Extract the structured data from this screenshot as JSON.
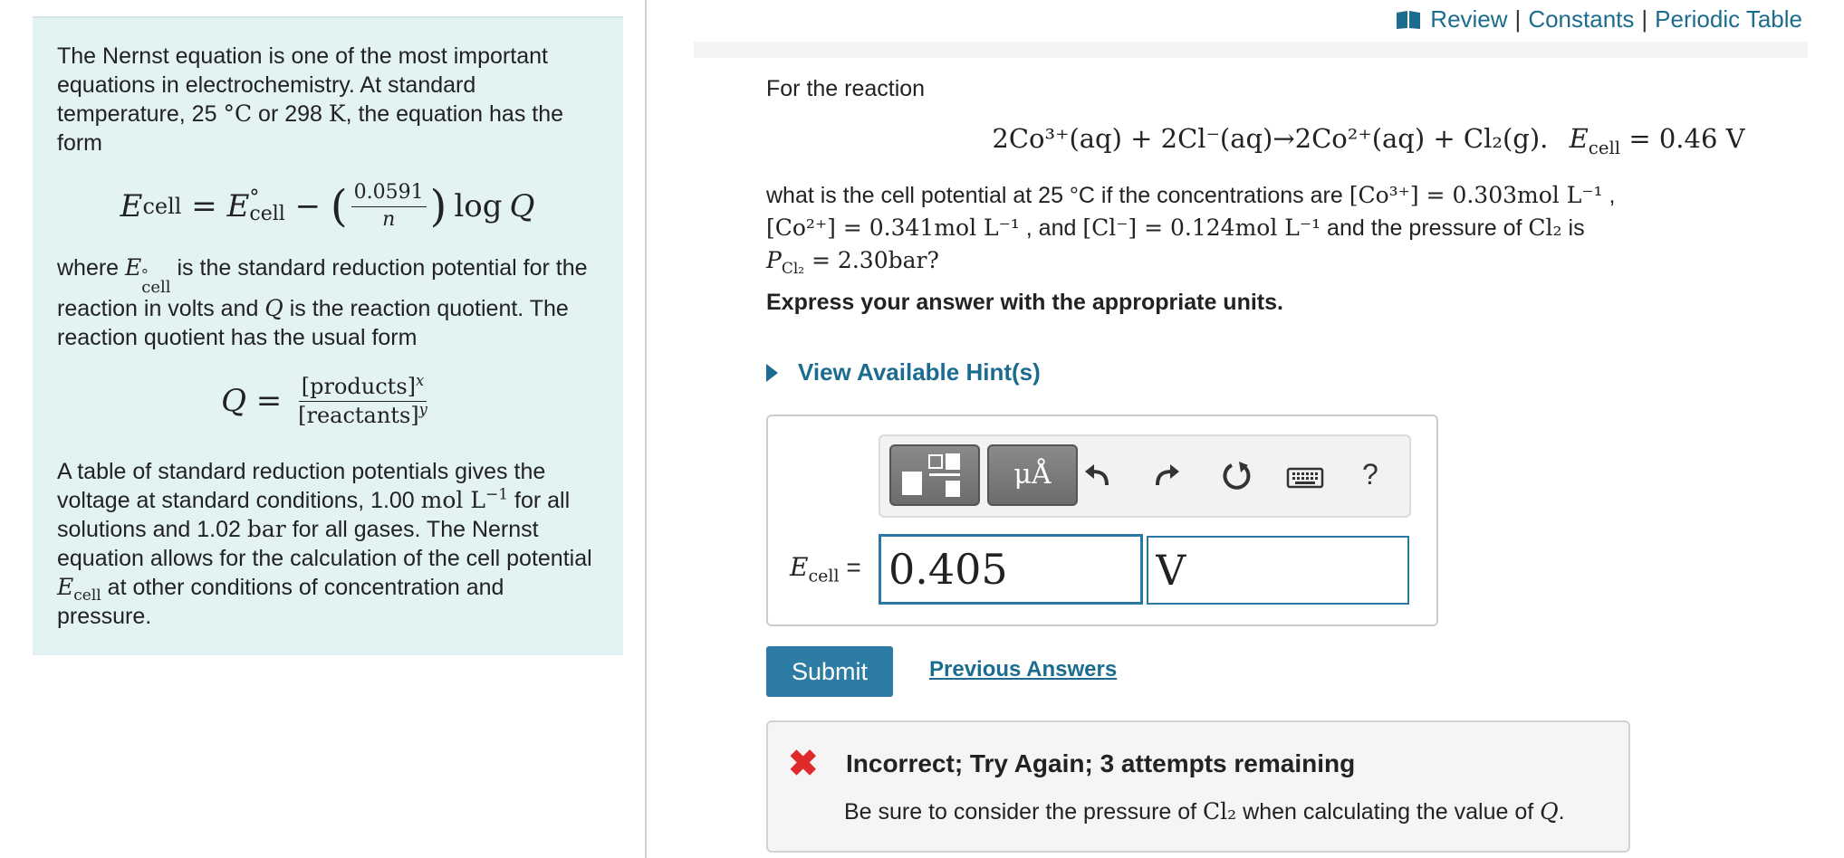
{
  "left": {
    "p1_text": "The Nernst equation is one of the most important equations in electrochemistry. At standard temperature, 25",
    "p1_deg": "°C",
    "p1_or": " or 298 ",
    "p1_k": "K",
    "p1_end": ", the equation has the form",
    "eq_nernst": {
      "lhs": "E",
      "lhs_sub": "cell",
      "eq": " = ",
      "e0": "E",
      "e0_sup": "°",
      "e0_sub": "cell",
      "minus": " − ",
      "num": "0.0591",
      "den": "n",
      "log": "log",
      "q": "Q"
    },
    "p2_where": "where ",
    "p2_e": "E",
    "p2_sup": "°",
    "p2_sub": "cell",
    "p2_mid": " is the standard reduction potential for the reaction in volts and ",
    "p2_q": "Q",
    "p2_end": " is the reaction quotient. The reaction quotient has the usual form",
    "eq_q": {
      "lhs": "Q",
      "eq": " = ",
      "num": "[products]",
      "num_sup": "x",
      "den": "[reactants]",
      "den_sup": "y"
    },
    "p3_a": "A table of standard reduction potentials gives the voltage at standard conditions, 1.00 ",
    "p3_unit": "mol L",
    "p3_unit_sup": "−1",
    "p3_b": " for all solutions and 1.02 ",
    "p3_bar": "bar",
    "p3_c": " for all gases. The Nernst equation allows for the calculation of the cell potential ",
    "p3_e": "E",
    "p3_esub": "cell",
    "p3_d": " at other conditions of concentration and pressure."
  },
  "top_links": {
    "review": "Review",
    "constants": "Constants",
    "periodic": "Periodic Table",
    "sep": "|"
  },
  "question": {
    "intro": "For the reaction",
    "reaction": "2Co³⁺(aq) + 2Cl⁻(aq)→2Co²⁺(aq) + Cl₂(g).",
    "e0_label": "E",
    "e0_sub": "cell",
    "e0_value": " = 0.46 V",
    "q_a": "what is the cell potential at 25 °C if the concentrations are ",
    "q_co3": "[Co³⁺] = 0.303mol L⁻¹",
    "q_comma": " ,",
    "q_co2": "[Co²⁺] = 0.341mol L⁻¹",
    "q_and": " , and ",
    "q_cl": "[Cl⁻] = 0.124mol L⁻¹",
    "q_press": " and the pressure of ",
    "q_cl2": "Cl₂",
    "q_is": " is",
    "q_p": "P",
    "q_psub": "Cl₂",
    "q_pval": " = 2.30bar?",
    "instruction": "Express your answer with the appropriate units."
  },
  "hint": {
    "label": "View Available Hint(s)"
  },
  "answer": {
    "label_e": "E",
    "label_sub": "cell",
    "label_eq": " =",
    "value": "0.405",
    "unit": "V",
    "units_btn": "μÅ",
    "help": "?"
  },
  "actions": {
    "submit": "Submit",
    "previous": "Previous Answers"
  },
  "feedback": {
    "mark": "✖",
    "title": "Incorrect; Try Again; 3 attempts remaining",
    "msg_a": "Be sure to consider the pressure of ",
    "msg_cl2": "Cl₂",
    "msg_b": " when calculating the value of ",
    "msg_q": "Q",
    "msg_end": "."
  },
  "colors": {
    "link": "#1c6c8f",
    "panel": "#e3f2f3",
    "error": "#e0292b",
    "button": "#2d7ca4"
  }
}
